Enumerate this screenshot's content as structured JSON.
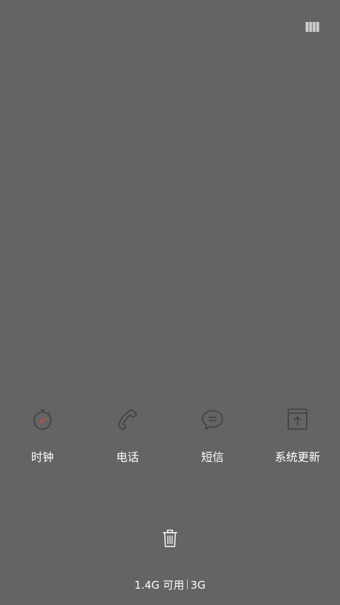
{
  "apps": [
    {
      "label": "时钟",
      "icon": "clock-icon"
    },
    {
      "label": "电话",
      "icon": "phone-icon"
    },
    {
      "label": "短信",
      "icon": "message-icon"
    },
    {
      "label": "系统更新",
      "icon": "system-update-icon"
    }
  ],
  "memory": {
    "available": "1.4G 可用",
    "total": "3G"
  },
  "icons": {
    "top_right": "view-mode-icon",
    "clear": "trash-icon"
  },
  "colors": {
    "background": "#646464",
    "text": "#ffffff",
    "clock_hand": "#d0473a",
    "icon_stroke": "#3f3f3f"
  }
}
